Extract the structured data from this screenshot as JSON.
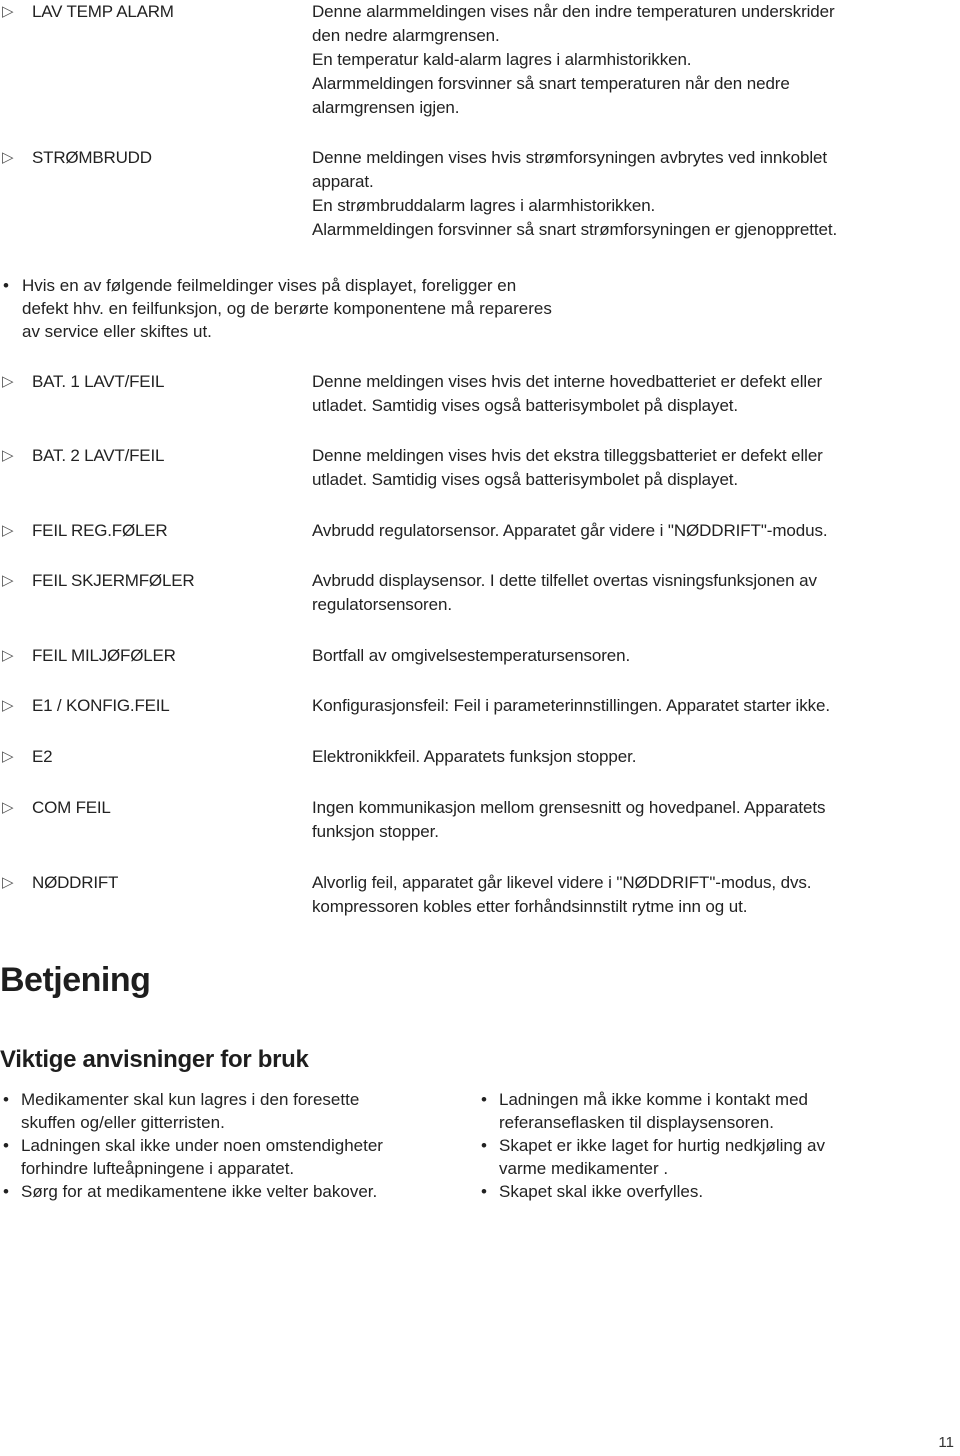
{
  "alarms": [
    {
      "code": "LAV TEMP ALARM",
      "description_lines": [
        "Denne alarmmeldingen vises når den indre temperaturen underskrider",
        "den nedre alarmgrensen.",
        "En temperatur kald-alarm lagres i alarmhistorikken.",
        "Alarmmeldingen forsvinner så snart temperaturen når den nedre",
        "alarmgrensen igjen."
      ]
    },
    {
      "code": "STRØMBRUDD",
      "description_lines": [
        "Denne meldingen vises hvis strømforsyningen avbrytes ved innkoblet",
        "apparat.",
        "En strømbruddalarm lagres i alarmhistorikken.",
        "Alarmmeldingen forsvinner så snart strømforsyningen er gjenopprettet."
      ]
    }
  ],
  "note": {
    "bullet": "•",
    "lines": [
      "Hvis en av følgende feilmeldinger vises på displayet, foreligger en",
      "defekt hhv. en feilfunksjon, og de berørte komponentene må repareres",
      "av service eller skiftes ut."
    ]
  },
  "errors": [
    {
      "code": "BAT. 1 LAVT/FEIL",
      "description_lines": [
        "Denne meldingen vises hvis det interne hovedbatteriet er defekt eller",
        "utladet. Samtidig vises også batterisymbolet på displayet."
      ]
    },
    {
      "code": "BAT. 2 LAVT/FEIL",
      "description_lines": [
        "Denne meldingen vises hvis det ekstra tilleggsbatteriet er defekt eller",
        "utladet. Samtidig vises også batterisymbolet på displayet."
      ]
    },
    {
      "code": "FEIL REG.FØLER",
      "description_lines": [
        "Avbrudd regulatorsensor. Apparatet går videre i \"NØDDRIFT\"-modus."
      ]
    },
    {
      "code": "FEIL SKJERMFØLER",
      "description_lines": [
        "Avbrudd displaysensor. I dette tilfellet overtas visningsfunksjonen av",
        "regulatorsensoren."
      ]
    },
    {
      "code": "FEIL MILJØFØLER",
      "description_lines": [
        "Bortfall av omgivelsestemperatursensoren."
      ]
    },
    {
      "code": "E1 / KONFIG.FEIL",
      "description_lines": [
        "Konfigurasjonsfeil: Feil i parameterinnstillingen. Apparatet starter ikke."
      ]
    },
    {
      "code": "E2",
      "description_lines": [
        "Elektronikkfeil. Apparatets funksjon stopper."
      ]
    },
    {
      "code": "COM FEIL",
      "description_lines": [
        "Ingen kommunikasjon mellom grensesnitt og hovedpanel. Apparatets",
        "funksjon stopper."
      ]
    },
    {
      "code": "NØDDRIFT",
      "description_lines": [
        "Alvorlig feil, apparatet går likevel videre i \"NØDDRIFT\"-modus, dvs.",
        "kompressoren kobles etter forhåndsinnstilt rytme inn og ut."
      ]
    }
  ],
  "arrow_icon": "▷",
  "section": {
    "title": "Betjening",
    "subtitle": "Viktige anvisninger for bruk",
    "bullet": "•",
    "left_items": [
      [
        "Medikamenter skal kun lagres i den foresette",
        "skuffen og/eller gitterristen."
      ],
      [
        "Ladningen skal ikke under noen omstendigheter",
        "forhindre lufteåpningene i apparatet."
      ],
      [
        "Sørg for at medikamentene ikke velter bakover."
      ]
    ],
    "right_items": [
      [
        "Ladningen må ikke komme i kontakt med",
        "referanseflasken til displaysensoren."
      ],
      [
        "Skapet er ikke laget for hurtig nedkjøling av",
        "varme medikamenter ."
      ],
      [
        "Skapet skal ikke overfylles."
      ]
    ]
  },
  "page_number": "11"
}
